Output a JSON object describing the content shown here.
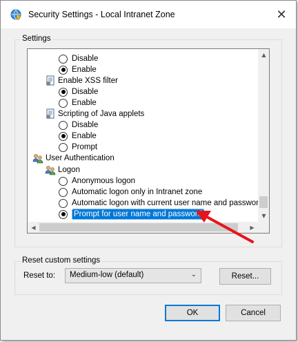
{
  "window": {
    "title": "Security Settings - Local Intranet Zone",
    "icons": {
      "app": "globe-shield-icon",
      "close": "close-icon"
    },
    "close_glyph": "✕"
  },
  "settings": {
    "group_label": "Settings",
    "tree": [
      {
        "kind": "radio",
        "label": "Disable",
        "selected": false
      },
      {
        "kind": "radio",
        "label": "Enable",
        "selected": true
      },
      {
        "kind": "category",
        "label": "Enable XSS filter",
        "icon": "settings-page-icon"
      },
      {
        "kind": "radio",
        "label": "Disable",
        "selected": true
      },
      {
        "kind": "radio",
        "label": "Enable",
        "selected": false
      },
      {
        "kind": "category",
        "label": "Scripting of Java applets",
        "icon": "settings-page-icon"
      },
      {
        "kind": "radio",
        "label": "Disable",
        "selected": false
      },
      {
        "kind": "radio",
        "label": "Enable",
        "selected": true
      },
      {
        "kind": "radio",
        "label": "Prompt",
        "selected": false
      },
      {
        "kind": "category",
        "label": "User Authentication",
        "icon": "users-icon"
      },
      {
        "kind": "category",
        "label": "Logon",
        "icon": "users-icon"
      },
      {
        "kind": "radio",
        "label": "Anonymous logon",
        "selected": false
      },
      {
        "kind": "radio",
        "label": "Automatic logon only in Intranet zone",
        "selected": false
      },
      {
        "kind": "radio",
        "label": "Automatic logon with current user name and password",
        "selected": false
      },
      {
        "kind": "radio",
        "label": "Prompt for user name and password",
        "selected": true,
        "highlighted": true
      }
    ],
    "scroll": {
      "up": "▲",
      "down": "▼",
      "left": "◀",
      "right": "▶"
    }
  },
  "reset": {
    "group_label": "Reset custom settings",
    "reset_to_label": "Reset to:",
    "dropdown_value": "Medium-low (default)",
    "dropdown_caret": "⌄",
    "reset_button": "Reset..."
  },
  "buttons": {
    "ok": "OK",
    "cancel": "Cancel"
  },
  "annotation": {
    "arrow_color": "#e8141c"
  },
  "colors": {
    "selection": "#0078d7",
    "default_button_border": "#0078d7"
  }
}
